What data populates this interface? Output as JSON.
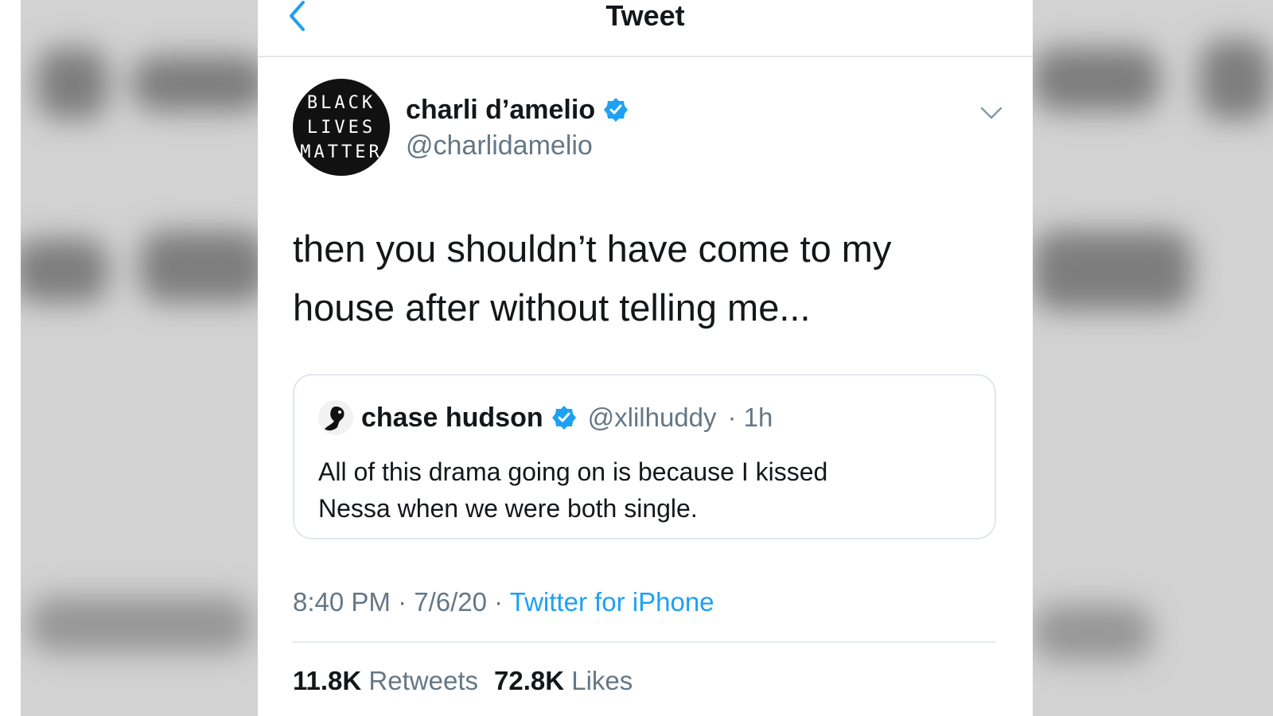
{
  "header": {
    "title": "Tweet",
    "back_icon": "chevron-left-icon"
  },
  "tweet": {
    "avatar_lines": [
      "BLACK",
      "LIVES",
      "MATTER"
    ],
    "author_name": "charli d’amelio",
    "author_handle": "@charlidamelio",
    "text": "then you shouldn’t have come to my\nhouse after without telling me...",
    "quoted": {
      "name": "chase hudson",
      "handle": "@xlilhuddy",
      "time": "· 1h",
      "text": "All of this drama going on is because I kissed\nNessa when we were both single."
    },
    "time": "8:40 PM",
    "date": "7/6/20",
    "separator": "·",
    "source": "Twitter for iPhone",
    "retweets_count": "11.8K",
    "retweets_label": "Retweets",
    "likes_count": "72.8K",
    "likes_label": "Likes"
  },
  "colors": {
    "accent": "#1da1f2",
    "text": "#14171a",
    "muted": "#657786"
  }
}
